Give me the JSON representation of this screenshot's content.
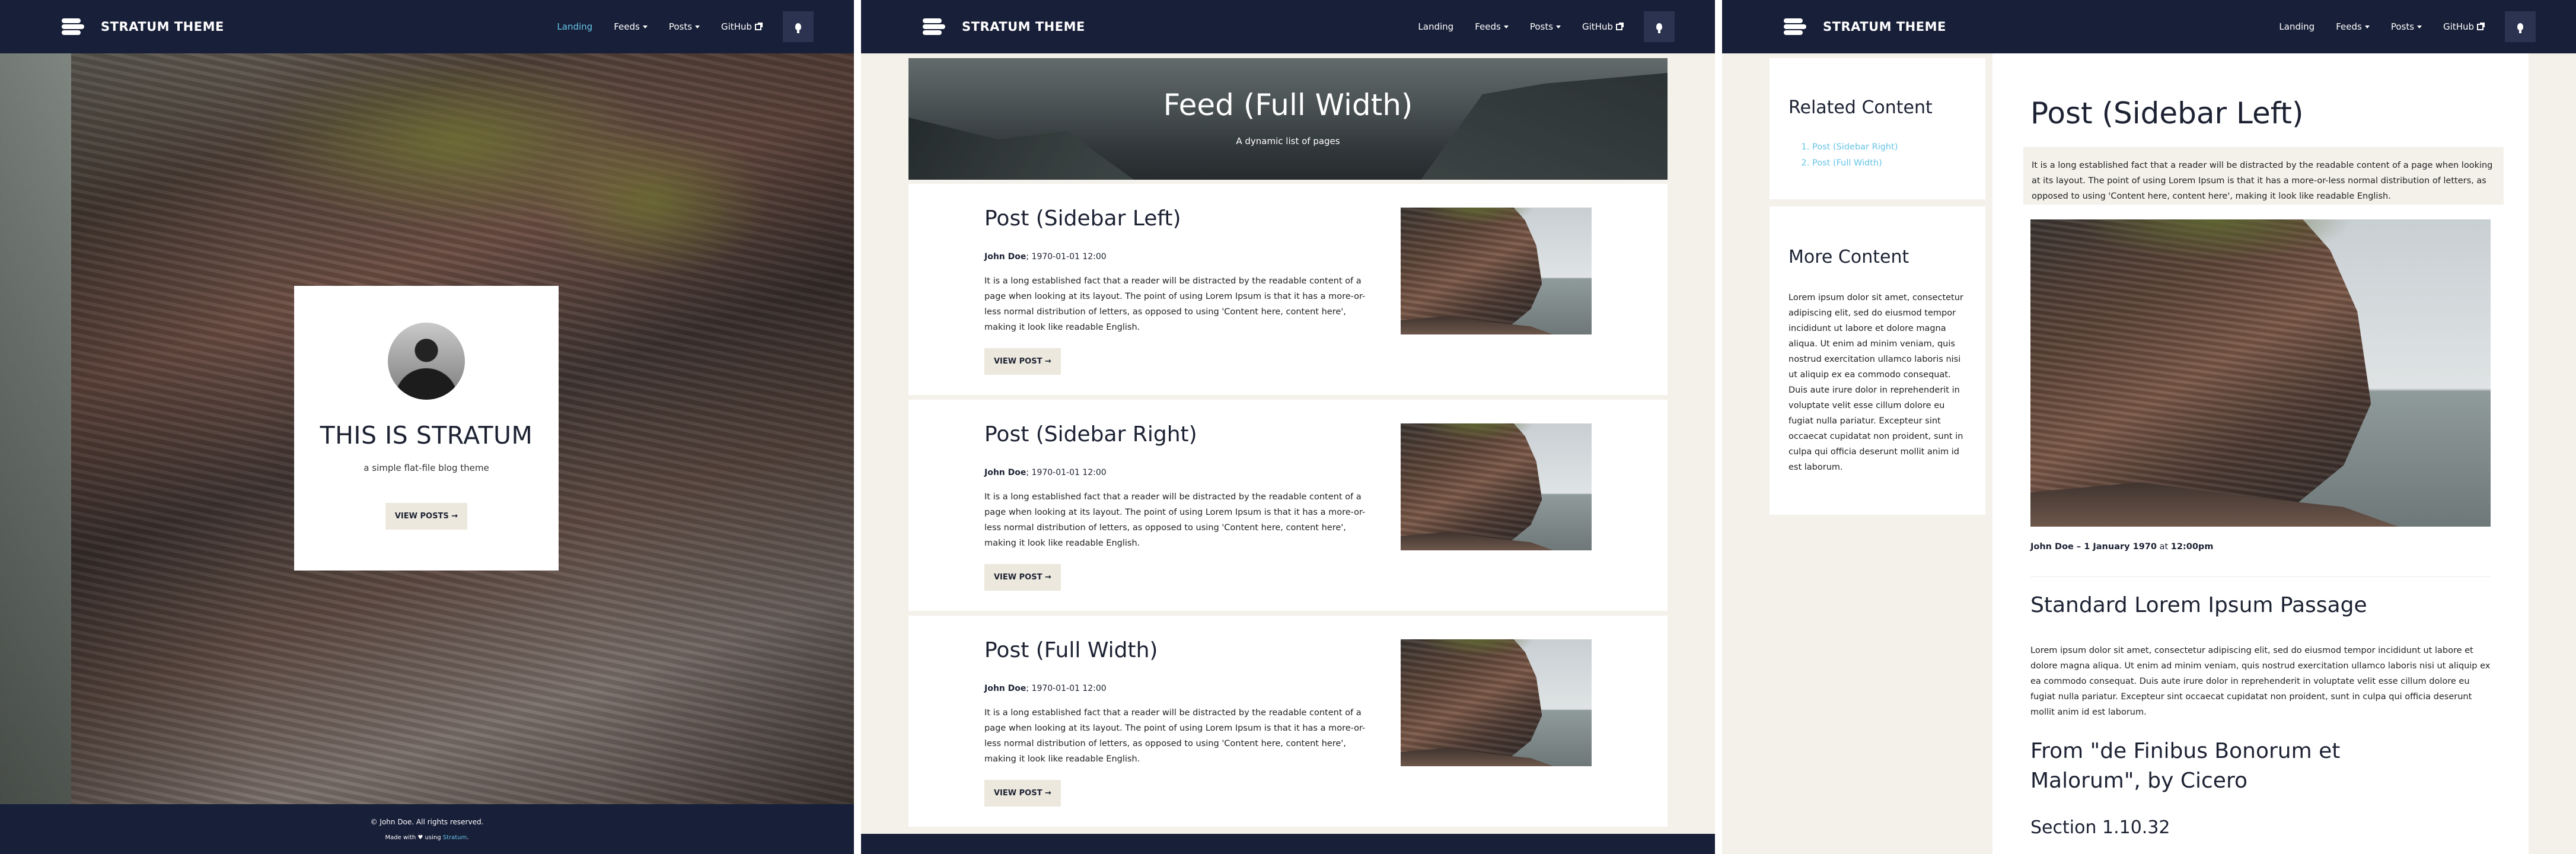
{
  "navbar": {
    "brand": "STRATUM THEME",
    "items": [
      {
        "label": "Landing"
      },
      {
        "label": "Feeds"
      },
      {
        "label": "Posts"
      },
      {
        "label": "GitHub"
      }
    ],
    "active_color": "#66c5e6",
    "background": "#181f38"
  },
  "landing": {
    "title": "THIS IS STRATUM",
    "subtitle": "a simple flat-file blog theme",
    "button": "VIEW POSTS →",
    "footer": {
      "copyright": "© John Doe. All rights reserved.",
      "made_prefix": "Made with",
      "heart": "♥",
      "made_using": "using",
      "made_link": "Stratum",
      "made_suffix": "."
    }
  },
  "feed": {
    "title": "Feed (Full Width)",
    "description": "A dynamic list of pages",
    "posts": [
      {
        "title": "Post (Sidebar Left)",
        "author": "John Doe",
        "date": "; 1970-01-01 12:00",
        "excerpt": "It is a long established fact that a reader will be distracted by the readable content of a page when looking at its layout. The point of using Lorem Ipsum is that it has a more-or-less normal distribution of letters, as opposed to using 'Content here, content here', making it look like readable English.",
        "button": "VIEW POST →"
      },
      {
        "title": "Post (Sidebar Right)",
        "author": "John Doe",
        "date": "; 1970-01-01 12:00",
        "excerpt": "It is a long established fact that a reader will be distracted by the readable content of a page when looking at its layout. The point of using Lorem Ipsum is that it has a more-or-less normal distribution of letters, as opposed to using 'Content here, content here', making it look like readable English.",
        "button": "VIEW POST →"
      },
      {
        "title": "Post (Full Width)",
        "author": "John Doe",
        "date": "; 1970-01-01 12:00",
        "excerpt": "It is a long established fact that a reader will be distracted by the readable content of a page when looking at its layout. The point of using Lorem Ipsum is that it has a more-or-less normal distribution of letters, as opposed to using 'Content here, content here', making it look like readable English.",
        "button": "VIEW POST →"
      }
    ]
  },
  "post_page": {
    "sidebar": {
      "related_title": "Related Content",
      "related_links": [
        "Post (Sidebar Right)",
        "Post (Full Width)"
      ],
      "more_title": "More Content",
      "more_text": "Lorem ipsum dolor sit amet, consectetur adipiscing elit, sed do eiusmod tempor incididunt ut labore et dolore magna aliqua. Ut enim ad minim veniam, quis nostrud exercitation ullamco laboris nisi ut aliquip ex ea commodo consequat. Duis aute irure dolor in reprehenderit in voluptate velit esse cillum dolore eu fugiat nulla pariatur. Excepteur sint occaecat cupidatat non proident, sunt in culpa qui officia deserunt mollit anim id est laborum."
    },
    "title": "Post (Sidebar Left)",
    "summary": "It is a long established fact that a reader will be distracted by the readable content of a page when looking at its layout. The point of using Lorem Ipsum is that it has a more-or-less normal distribution of letters, as opposed to using 'Content here, content here', making it look like readable English.",
    "byline": {
      "author_date": "John Doe – 1 January 1970",
      "at": "at",
      "time": "12:00pm"
    },
    "h2_1": "Standard Lorem Ipsum Passage",
    "p_1": "Lorem ipsum dolor sit amet, consectetur adipiscing elit, sed do eiusmod tempor incididunt ut labore et dolore magna aliqua. Ut enim ad minim veniam, quis nostrud exercitation ullamco laboris nisi ut aliquip ex ea commodo consequat. Duis aute irure dolor in reprehenderit in voluptate velit esse cillum dolore eu fugiat nulla pariatur. Excepteur sint occaecat cupidatat non proident, sunt in culpa qui officia deserunt mollit anim id est laborum.",
    "h2_2": "From \"de Finibus Bonorum et Malorum\", by Cicero",
    "h3_1": "Section 1.10.32"
  },
  "icons": {
    "logo": "stratum-logo-icon",
    "theme_toggle": "lightbulb-icon",
    "external": "external-link-icon",
    "caret": "chevron-down-icon"
  }
}
